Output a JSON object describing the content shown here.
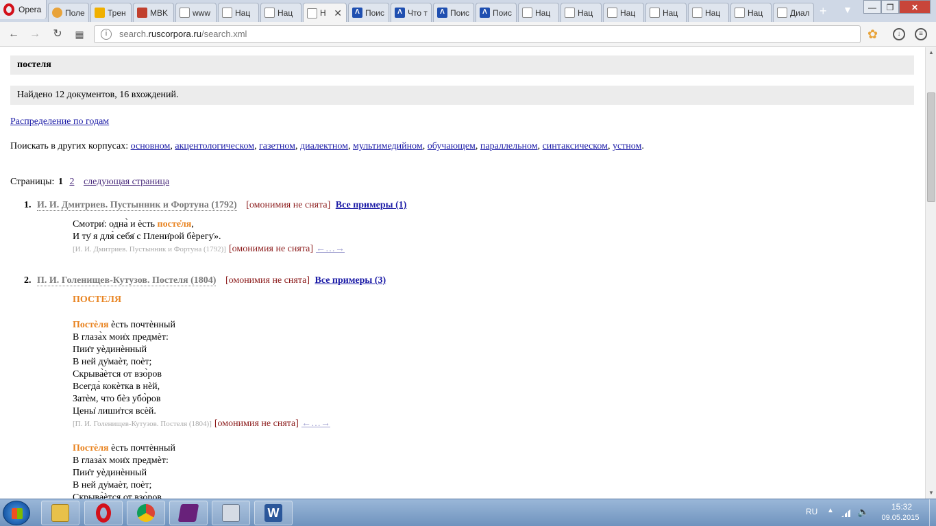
{
  "browser": {
    "opera_label": "Opera",
    "tabs": [
      {
        "label": "Поле",
        "icon": "orange-icon"
      },
      {
        "label": "Трен",
        "icon": "star-icon"
      },
      {
        "label": "MBK",
        "icon": "red-icon"
      },
      {
        "label": "www",
        "icon": "page-icon"
      },
      {
        "label": "Нац",
        "icon": "page-icon"
      },
      {
        "label": "Нац",
        "icon": "page-icon"
      },
      {
        "label": "Н",
        "icon": "page-icon",
        "active": true
      },
      {
        "label": "Поис",
        "icon": "blue-icon"
      },
      {
        "label": "Что т",
        "icon": "blue-icon"
      },
      {
        "label": "Поис",
        "icon": "blue-icon"
      },
      {
        "label": "Поис",
        "icon": "blue-icon"
      },
      {
        "label": "Нац",
        "icon": "page-icon"
      },
      {
        "label": "Нац",
        "icon": "page-icon"
      },
      {
        "label": "Нац",
        "icon": "page-icon"
      },
      {
        "label": "Нац",
        "icon": "page-icon"
      },
      {
        "label": "Нац",
        "icon": "page-icon"
      },
      {
        "label": "Нац",
        "icon": "page-icon"
      },
      {
        "label": "Диал",
        "icon": "page-icon"
      }
    ],
    "url_domain_prefix": "search.",
    "url_domain": "ruscorpora.ru",
    "url_path": "/search.xml"
  },
  "page": {
    "query": "постеля",
    "found": "Найдено 12 документов, 16 вхождений.",
    "distribution_link": "Распределение по годам",
    "other_corpora_label": "Поискать в других корпусах:",
    "other_corpora": [
      "основном",
      "акцентологическом",
      "газетном",
      "диалектном",
      "мультимедийном",
      "обучающем",
      "параллельном",
      "синтаксическом",
      "устном"
    ],
    "pages_label": "Страницы:",
    "current_page": "1",
    "page_2": "2",
    "next_page": "следующая страница",
    "homonymy": "[омонимия не снята]",
    "arrows": "←…→",
    "doc1": {
      "num": "1.",
      "title": "И. И. Дмитриев. Пустынник и Фортуна (1792)",
      "all_examples": "Все примеры (1)",
      "line1_pre": "Смотри̇: одна̀ и ѐсть ",
      "line1_hit": "посте̇ля",
      "line1_post": ",",
      "line2": "И ту̇ я для̀ себя̇ с Плени̇рой бѐрегу̇».",
      "source": "[И. И. Дмитриев. Пустынник и Фортуна (1792)]"
    },
    "doc2": {
      "num": "2.",
      "title": "П. И. Голенищев-Кутузов. Постеля (1804)",
      "all_examples": "Все примеры (3)",
      "heading": "ПОСТЕЛЯ",
      "hit": "Постѐля",
      "line1_post": " ѐсть почтѐнный",
      "lines": [
        "В глаза̀х мои̇х предмѐт:",
        "Пии̇т уѐдинѐнный",
        "В ней ду̇маѐт, поѐт;",
        "Скрыва̀ѐтся от взо̀ров",
        "Всегда̀ кокѐтка в нѐй,",
        "Затѐм, что бѐз убо̀ров",
        "Цены̇ лиши̇тся всѐй."
      ],
      "source": "[П. И. Голенищев-Кутузов. Постеля (1804)]",
      "second_lines": [
        "В глаза̀х мои̇х предмѐт:",
        "Пии̇т уѐдинѐнный",
        "В ней ду̇маѐт, поѐт;",
        "Скрыва̀ѐтся от взо̀ров"
      ]
    }
  },
  "taskbar": {
    "lang": "RU",
    "time": "15:32",
    "date": "09.05.2015",
    "word_label": "W"
  }
}
